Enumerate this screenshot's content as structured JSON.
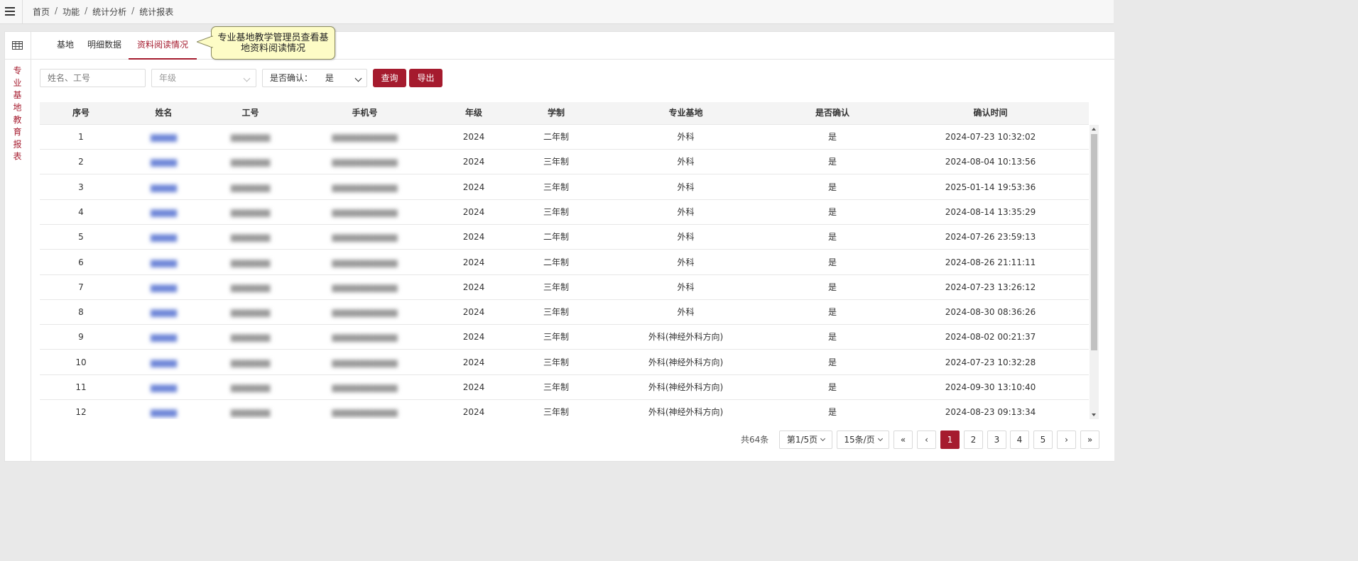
{
  "breadcrumb": {
    "items": [
      "首页",
      "功能",
      "统计分析",
      "统计报表"
    ],
    "separator": "/"
  },
  "sidebar": {
    "title": "专业基地教育报表"
  },
  "tabs": [
    {
      "label": "基地",
      "active": false
    },
    {
      "label": "明细数据",
      "active": false
    },
    {
      "label": "资料阅读情况",
      "active": true
    }
  ],
  "tooltip": {
    "text": "专业基地教学管理员查看基地资料阅读情况"
  },
  "filters": {
    "name_placeholder": "姓名、工号",
    "grade_placeholder": "年级",
    "confirm_label": "是否确认：",
    "confirm_value": "是",
    "query_label": "查询",
    "export_label": "导出"
  },
  "table": {
    "columns": [
      "序号",
      "姓名",
      "工号",
      "手机号",
      "年级",
      "学制",
      "专业基地",
      "是否确认",
      "确认时间"
    ],
    "rows": [
      {
        "no": "1",
        "name": "",
        "id": "",
        "phone": "",
        "grade": "2024",
        "system": "二年制",
        "base": "外科",
        "confirmed": "是",
        "time": "2024-07-23 10:32:02"
      },
      {
        "no": "2",
        "name": "",
        "id": "",
        "phone": "",
        "grade": "2024",
        "system": "三年制",
        "base": "外科",
        "confirmed": "是",
        "time": "2024-08-04 10:13:56"
      },
      {
        "no": "3",
        "name": "",
        "id": "",
        "phone": "",
        "grade": "2024",
        "system": "三年制",
        "base": "外科",
        "confirmed": "是",
        "time": "2025-01-14 19:53:36"
      },
      {
        "no": "4",
        "name": "",
        "id": "",
        "phone": "",
        "grade": "2024",
        "system": "三年制",
        "base": "外科",
        "confirmed": "是",
        "time": "2024-08-14 13:35:29"
      },
      {
        "no": "5",
        "name": "",
        "id": "",
        "phone": "",
        "grade": "2024",
        "system": "二年制",
        "base": "外科",
        "confirmed": "是",
        "time": "2024-07-26 23:59:13"
      },
      {
        "no": "6",
        "name": "",
        "id": "",
        "phone": "",
        "grade": "2024",
        "system": "二年制",
        "base": "外科",
        "confirmed": "是",
        "time": "2024-08-26 21:11:11"
      },
      {
        "no": "7",
        "name": "",
        "id": "",
        "phone": "",
        "grade": "2024",
        "system": "三年制",
        "base": "外科",
        "confirmed": "是",
        "time": "2024-07-23 13:26:12"
      },
      {
        "no": "8",
        "name": "",
        "id": "",
        "phone": "",
        "grade": "2024",
        "system": "三年制",
        "base": "外科",
        "confirmed": "是",
        "time": "2024-08-30 08:36:26"
      },
      {
        "no": "9",
        "name": "",
        "id": "",
        "phone": "",
        "grade": "2024",
        "system": "三年制",
        "base": "外科(神经外科方向)",
        "confirmed": "是",
        "time": "2024-08-02 00:21:37"
      },
      {
        "no": "10",
        "name": "",
        "id": "",
        "phone": "",
        "grade": "2024",
        "system": "三年制",
        "base": "外科(神经外科方向)",
        "confirmed": "是",
        "time": "2024-07-23 10:32:28"
      },
      {
        "no": "11",
        "name": "",
        "id": "",
        "phone": "",
        "grade": "2024",
        "system": "三年制",
        "base": "外科(神经外科方向)",
        "confirmed": "是",
        "time": "2024-09-30 13:10:40"
      },
      {
        "no": "12",
        "name": "",
        "id": "",
        "phone": "",
        "grade": "2024",
        "system": "三年制",
        "base": "外科(神经外科方向)",
        "confirmed": "是",
        "time": "2024-08-23 09:13:34"
      }
    ]
  },
  "pagination": {
    "total": "共64条",
    "page_select": "第1/5页",
    "size_select": "15条/页",
    "first": "«",
    "prev": "‹",
    "pages": [
      "1",
      "2",
      "3",
      "4",
      "5"
    ],
    "next": "›",
    "last": "»",
    "current": 1
  },
  "colors": {
    "accent": "#a51b2e",
    "tooltip_bg": "#fdfcc6"
  }
}
